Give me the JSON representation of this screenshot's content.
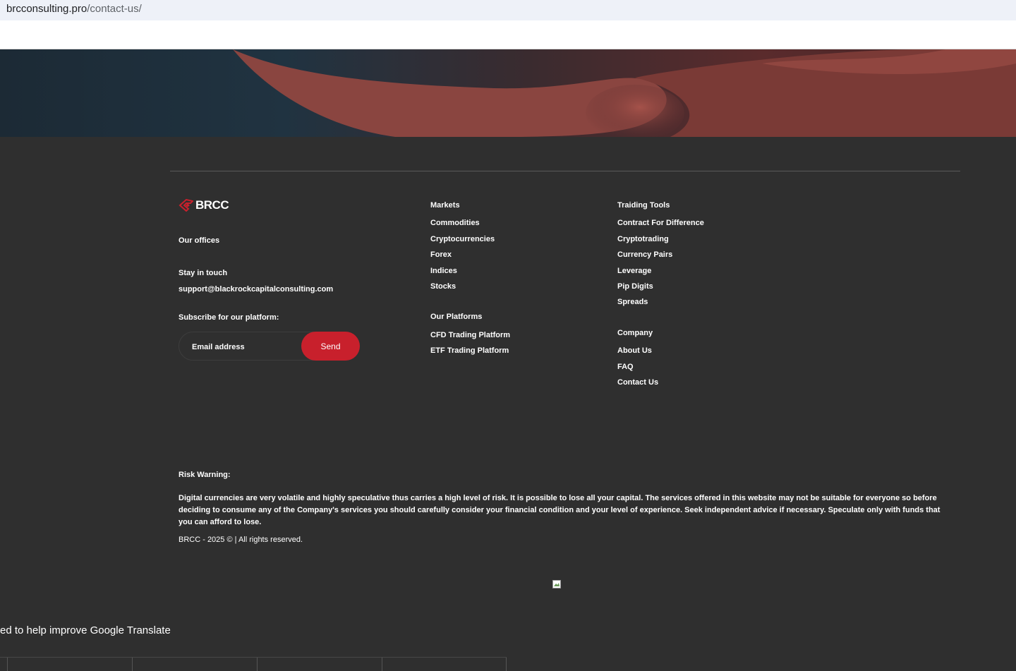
{
  "browser": {
    "url_host": "brcconsulting.pro",
    "url_path": "/contact-us/"
  },
  "brand": {
    "name": "BRCC",
    "accent_color": "#c8202c"
  },
  "left_column": {
    "offices_title": "Our offices",
    "stay_title": "Stay in touch",
    "email": "support@blackrockcapitalconsulting.com",
    "subscribe_title": "Subscribe for our platform:",
    "email_placeholder": "Email address",
    "send_label": "Send"
  },
  "markets": {
    "title": "Markets",
    "items": [
      "Commodities",
      "Cryptocurrencies",
      "Forex",
      "Indices",
      "Stocks"
    ]
  },
  "platforms": {
    "title": "Our Platforms",
    "items": [
      "CFD Trading Platform",
      "ETF Trading Platform"
    ]
  },
  "tools": {
    "title": "Traiding Tools",
    "items": [
      "Contract For Difference",
      "Cryptotrading",
      "Currency Pairs",
      "Leverage",
      "Pip Digits",
      "Spreads"
    ]
  },
  "company": {
    "title": "Company",
    "items": [
      "About Us",
      "FAQ",
      "Contact Us"
    ]
  },
  "risk": {
    "title": "Risk Warning:",
    "text": "Digital currencies are very volatile and highly speculative thus carries a high level of risk. It is possible to lose all your capital. The services offered in this website may not be suitable for everyone so before deciding to consume any of the Company's services you should carefully consider your financial condition and your level of experience. Seek independent advice if necessary. Speculate only with funds that you can afford to lose.",
    "copyright": "BRCC - 2025 © | All rights reserved."
  },
  "translate_banner": {
    "text": "ed to help improve Google Translate"
  }
}
